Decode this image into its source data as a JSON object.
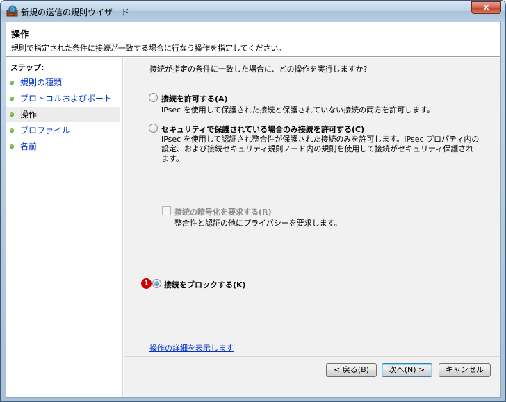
{
  "window": {
    "title": "新規の送信の規則ウイザード",
    "close_glyph": "x"
  },
  "header": {
    "title": "操作",
    "description": "規則で指定された条件に接続が一致する場合に行なう操作を指定してください。"
  },
  "sidebar": {
    "steps_label": "ステップ:",
    "items": [
      {
        "label": "規則の種類"
      },
      {
        "label": "プロトコルおよびポート"
      },
      {
        "label": "操作"
      },
      {
        "label": "プロファイル"
      },
      {
        "label": "名前"
      }
    ]
  },
  "main": {
    "question": "接続が指定の条件に一致した場合に、どの操作を実行しますか?",
    "options": [
      {
        "label": "接続を許可する(A)",
        "desc": "IPsec を使用して保護された接続と保護されていない接続の両方を許可します。",
        "checked": false
      },
      {
        "label": "セキュリティで保護されている場合のみ接続を許可する(C)",
        "desc": "IPsec を使用して認証され整合性が保護された接続のみを許可します。IPsec プロパティ内の設定、および接続セキュリティ規則ノード内の規則を使用して接続がセキュリティ保護されます。",
        "checked": false
      },
      {
        "label": "接続をブロックする(K)",
        "checked": true
      }
    ],
    "encryption": {
      "label": "接続の暗号化を要求する(R)",
      "desc": "整合性と認証の他にプライバシーを要求します。",
      "enabled": false
    },
    "marker_number": "1",
    "details_link": "操作の詳細を表示します"
  },
  "footer": {
    "back": "< 戻る(B)",
    "next": "次へ(N) >",
    "cancel": "キャンセル"
  },
  "colors": {
    "link": "#0033cc",
    "step_dot": "#2e8b1a",
    "marker": "#cc0000",
    "close_button": "#c0442e"
  }
}
